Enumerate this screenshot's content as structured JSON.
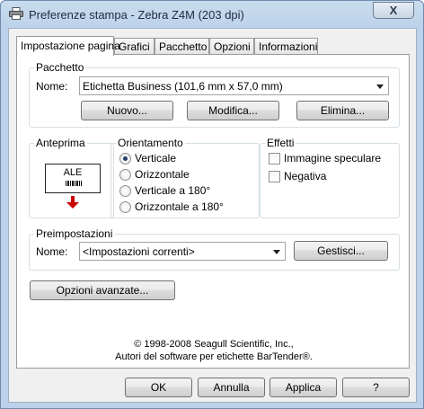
{
  "window": {
    "title": "Preferenze stampa - Zebra Z4M (203 dpi)",
    "close_glyph": "X"
  },
  "tabs": [
    {
      "label": "Impostazione pagina",
      "active": true
    },
    {
      "label": "Grafici",
      "active": false
    },
    {
      "label": "Pacchetto",
      "active": false
    },
    {
      "label": "Opzioni",
      "active": false
    },
    {
      "label": "Informazioni",
      "active": false
    }
  ],
  "pacchetto": {
    "group_label": "Pacchetto",
    "name_label": "Nome:",
    "selected": "Etichetta Business (101,6 mm x 57,0 mm)",
    "buttons": {
      "new": "Nuovo...",
      "edit": "Modifica...",
      "delete": "Elimina..."
    }
  },
  "anteprima": {
    "group_label": "Anteprima",
    "label_text": "ALE",
    "arrow_color": "#cc0000"
  },
  "orientamento": {
    "group_label": "Orientamento",
    "options": [
      {
        "label": "Verticale",
        "checked": true
      },
      {
        "label": "Orizzontale",
        "checked": false
      },
      {
        "label": "Verticale a 180°",
        "checked": false
      },
      {
        "label": "Orizzontale a 180°",
        "checked": false
      }
    ]
  },
  "effetti": {
    "group_label": "Effetti",
    "options": [
      {
        "label": "Immagine speculare",
        "checked": false
      },
      {
        "label": "Negativa",
        "checked": false
      }
    ]
  },
  "preimpostazioni": {
    "group_label": "Preimpostazioni",
    "name_label": "Nome:",
    "selected": "<Impostazioni correnti>",
    "manage_button": "Gestisci..."
  },
  "advanced_button": "Opzioni avanzate...",
  "copyright": {
    "line1": "© 1998-2008 Seagull Scientific, Inc.,",
    "line2": "Autori del software per etichette BarTender®."
  },
  "footer": {
    "ok": "OK",
    "cancel": "Annulla",
    "apply": "Applica",
    "help": "?"
  }
}
